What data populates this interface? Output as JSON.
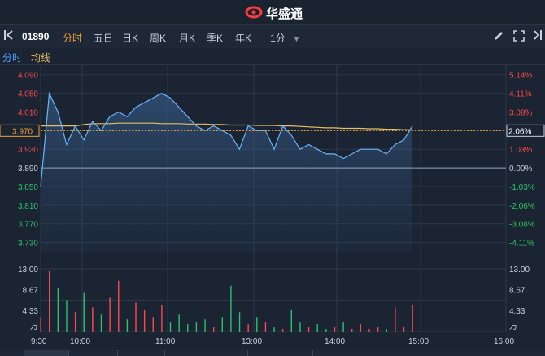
{
  "brand": {
    "name": "华盛通"
  },
  "toolbar": {
    "code": "01890",
    "timeframes": [
      "分时",
      "五日",
      "日K",
      "周K",
      "月K",
      "季K",
      "年K",
      "1分"
    ],
    "active": "分时",
    "icons": [
      "pencil-icon",
      "expand-icon",
      "sidebar-collapse-icon"
    ]
  },
  "legend": {
    "timeshare": "分时",
    "avg": "均线",
    "timeshare_color": "#4aa3ff",
    "avg_color": "#e5c060"
  },
  "price_axis": {
    "left_labels": [
      "4.090",
      "4.050",
      "4.010",
      "3.970",
      "3.930",
      "3.890",
      "3.850",
      "3.810",
      "3.770",
      "3.730"
    ],
    "right_labels": [
      "5.14%",
      "4.11%",
      "3.08%",
      "2.06%",
      "1.03%",
      "0.00%",
      "-1.03%",
      "-2.06%",
      "-3.08%",
      "-4.11%"
    ],
    "current_price": "3.970",
    "current_pct": "2.06%",
    "prev_close": 3.89
  },
  "volume_axis": {
    "left_labels": [
      "13.00",
      "8.67",
      "4.33",
      "万"
    ],
    "right_labels": [
      "13.00",
      "8.67",
      "4.33",
      "万"
    ]
  },
  "time_axis": [
    "9:30",
    "10:00",
    "11:00",
    "13:00",
    "14:00",
    "15:00",
    "16:00"
  ],
  "colors": {
    "up": "#ff4a4a",
    "down": "#2fc26a",
    "line": "#6ab6ff",
    "avg": "#e5c060",
    "grid": "#2c394b"
  },
  "chart_data": {
    "type": "line",
    "title": "",
    "xlabel": "",
    "ylabel": "",
    "ylim": [
      3.71,
      4.1
    ],
    "x_ticks": [
      "9:30",
      "10:00",
      "11:00",
      "13:00",
      "14:00",
      "15:00",
      "16:00"
    ],
    "series": [
      {
        "name": "分时",
        "values": [
          3.85,
          4.05,
          4.01,
          3.94,
          3.98,
          3.95,
          3.99,
          3.97,
          4.0,
          4.01,
          4.0,
          4.02,
          4.03,
          4.04,
          4.05,
          4.04,
          4.02,
          4.0,
          3.98,
          3.97,
          3.98,
          3.97,
          3.96,
          3.93,
          3.98,
          3.97,
          3.97,
          3.93,
          3.98,
          3.96,
          3.93,
          3.94,
          3.93,
          3.92,
          3.92,
          3.91,
          3.92,
          3.93,
          3.93,
          3.93,
          3.92,
          3.94,
          3.95,
          3.98
        ]
      },
      {
        "name": "均线",
        "values": [
          3.98,
          3.98,
          3.98,
          3.98,
          3.98,
          3.983,
          3.985,
          3.985,
          3.985,
          3.986,
          3.986,
          3.986,
          3.986,
          3.986,
          3.985,
          3.985,
          3.985,
          3.984,
          3.984,
          3.984,
          3.983,
          3.983,
          3.982,
          3.982,
          3.982,
          3.981,
          3.981,
          3.981,
          3.98,
          3.98,
          3.979,
          3.978,
          3.977,
          3.976,
          3.976,
          3.975,
          3.975,
          3.975,
          3.974,
          3.974,
          3.973,
          3.973,
          3.972,
          3.972
        ]
      }
    ],
    "volume": [
      3.0,
      12.5,
      9.0,
      6.5,
      4.0,
      8.0,
      5.0,
      3.5,
      7.0,
      10.5,
      2.5,
      6.0,
      4.5,
      3.0,
      5.5,
      2.0,
      3.5,
      1.5,
      2.0,
      2.5,
      1.0,
      3.0,
      9.5,
      4.0,
      1.5,
      3.0,
      2.0,
      1.0,
      0.5,
      4.5,
      2.0,
      1.0,
      1.5,
      0.5,
      1.0,
      2.0,
      0.5,
      1.5,
      0.5,
      1.0,
      0.5,
      5.0,
      1.0,
      5.5
    ]
  }
}
